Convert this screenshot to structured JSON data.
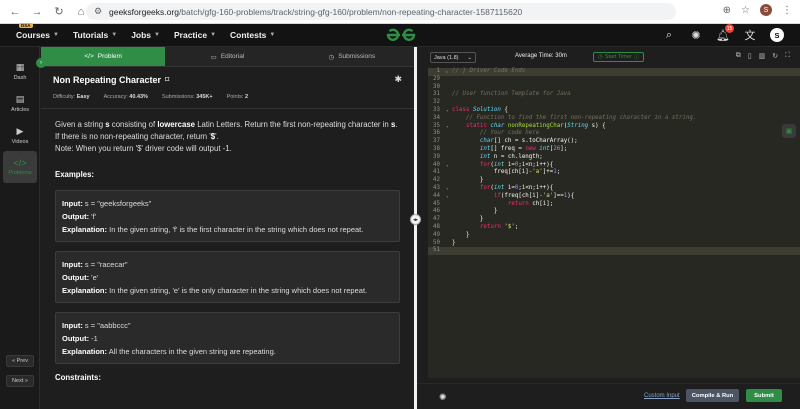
{
  "browser": {
    "url_domain": "geeksforgeeks.org",
    "url_path": "/batch/gfg-160-problems/track/string-gfg-160/problem/non-repeating-character-1587115620",
    "profile_initial": "S"
  },
  "header": {
    "menu": [
      {
        "label": "Courses",
        "badge": "DSA"
      },
      {
        "label": "Tutorials"
      },
      {
        "label": "Jobs"
      },
      {
        "label": "Practice"
      },
      {
        "label": "Contests"
      }
    ],
    "notification_count": "15",
    "avatar_initial": "S"
  },
  "rail": {
    "items": [
      {
        "label": "Dash",
        "icon": "grid-icon"
      },
      {
        "label": "Articles",
        "icon": "article-icon"
      },
      {
        "label": "Videos",
        "icon": "video-icon"
      },
      {
        "label": "Problems",
        "icon": "code-icon",
        "active": true
      }
    ],
    "prev_label": "Prev",
    "next_label": "Next"
  },
  "problem": {
    "tabs": [
      {
        "label": "Problem",
        "active": true
      },
      {
        "label": "Editorial"
      },
      {
        "label": "Submissions"
      }
    ],
    "title": "Non Repeating Character",
    "meta": {
      "difficulty_label": "Difficulty:",
      "difficulty": "Easy",
      "accuracy_label": "Accuracy:",
      "accuracy": "40.43%",
      "submissions_label": "Submissions:",
      "submissions": "345K+",
      "points_label": "Points:",
      "points": "2"
    },
    "desc_1a": "Given a string ",
    "desc_1b": "s",
    "desc_1c": " consisting of ",
    "desc_1d": "lowercase",
    "desc_1e": " Latin Letters. Return the first non-repeating character in ",
    "desc_2a": "s",
    "desc_2b": ". If there is no non-repeating character, return '",
    "desc_2c": "$",
    "desc_2d": "'.",
    "desc_note": "Note: When you return '$' driver code will output -1.",
    "examples_heading": "Examples:",
    "examples": [
      {
        "input": "s = \"geeksforgeeks\"",
        "output": "'f'",
        "explanation": "In the given string, 'f' is the first character in the string which does not repeat."
      },
      {
        "input": "s = \"racecar\"",
        "output": "'e'",
        "explanation": "In the given string, 'e' is the only character in the string which does not repeat."
      },
      {
        "input": "s = \"aabbccc\"",
        "output": "-1",
        "explanation": "All the characters in the given string are repeating."
      }
    ],
    "input_label": "Input:",
    "output_label": "Output:",
    "explanation_label": "Explanation:",
    "constraints_heading": "Constraints:"
  },
  "editor": {
    "language": "Java (1.8)",
    "avg_time": "Average Time: 30m",
    "start_timer": "Start Timer",
    "lines": [
      {
        "n": "1",
        "html": "<span class='cm'>// } Driver Code Ends</span>"
      },
      {
        "n": "29",
        "html": ""
      },
      {
        "n": "30",
        "html": ""
      },
      {
        "n": "31",
        "html": "<span class='cm'>// User function Template for Java</span>"
      },
      {
        "n": "32",
        "html": ""
      },
      {
        "n": "33",
        "html": "<span class='kw'>class</span> <span class='ty'>Solution</span> {"
      },
      {
        "n": "34",
        "html": "    <span class='cm'>// Function to find the first non-repeating character in a string.</span>"
      },
      {
        "n": "35",
        "html": "    <span class='kw'>static</span> <span class='ty'>char</span> <span class='fn'>nonRepeatingChar</span>(<span class='ty'>String</span> s) {"
      },
      {
        "n": "36",
        "html": "        <span class='cm'>// Your code here</span>"
      },
      {
        "n": "37",
        "html": "        <span class='ty'>char</span>[] ch = s.toCharArray();"
      },
      {
        "n": "38",
        "html": "        <span class='ty'>int</span>[] freq = <span class='kw'>new</span> <span class='ty'>int</span>[<span class='num'>26</span>];"
      },
      {
        "n": "39",
        "html": "        <span class='ty'>int</span> n = ch.length;"
      },
      {
        "n": "40",
        "html": "        <span class='kw'>for</span>(<span class='ty'>int</span> i=<span class='num'>0</span>;i&lt;n;i++){"
      },
      {
        "n": "41",
        "html": "            freq[ch[i]-<span class='str'>'a'</span>]+=<span class='num'>1</span>;"
      },
      {
        "n": "42",
        "html": "        }"
      },
      {
        "n": "43",
        "html": "        <span class='kw'>for</span>(<span class='ty'>int</span> i=<span class='num'>0</span>;i&lt;n;i++){"
      },
      {
        "n": "44",
        "html": "            <span class='kw'>if</span>(freq[ch[i]-<span class='str'>'a'</span>]==<span class='num'>1</span>){"
      },
      {
        "n": "45",
        "html": "                <span class='kw'>return</span> ch[i];"
      },
      {
        "n": "46",
        "html": "            }"
      },
      {
        "n": "47",
        "html": "        }"
      },
      {
        "n": "48",
        "html": "        <span class='kw'>return</span> <span class='str'>'$'</span>;"
      },
      {
        "n": "49",
        "html": "    }"
      },
      {
        "n": "50",
        "html": "}"
      },
      {
        "n": "51",
        "html": ""
      }
    ],
    "custom_input": "Custom Input",
    "compile_label": "Compile & Run",
    "submit_label": "Submit"
  },
  "colors": {
    "brand_green": "#2f8d46",
    "editor_bg": "#272822"
  }
}
